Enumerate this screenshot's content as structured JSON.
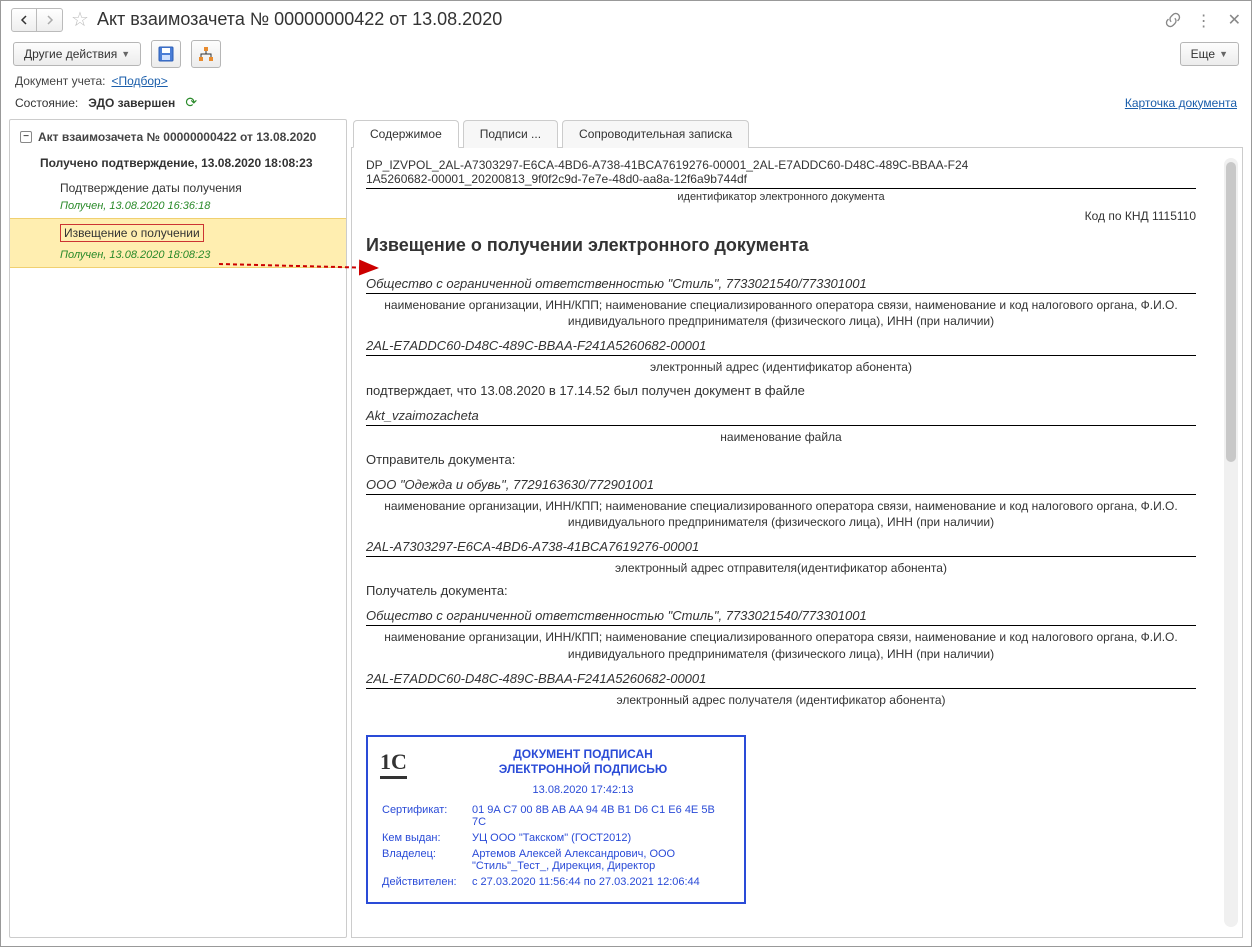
{
  "titlebar": {
    "title": "Акт взаимозачета № 00000000422 от 13.08.2020"
  },
  "toolbar": {
    "other_actions": "Другие действия",
    "more": "Еще"
  },
  "doc_link_row": {
    "label": "Документ учета:",
    "link": "<Подбор>"
  },
  "state_row": {
    "label": "Состояние:",
    "value": "ЭДО завершен",
    "card_link": "Карточка документа"
  },
  "tree": {
    "root": "Акт взаимозачета № 00000000422 от 13.08.2020",
    "subtitle": "Получено подтверждение, 13.08.2020 18:08:23",
    "item1": "Подтверждение даты получения",
    "status1": "Получен, 13.08.2020 16:36:18",
    "item2": "Извещение о получении",
    "status2": "Получен, 13.08.2020 18:08:23"
  },
  "tabs": {
    "t1": "Содержимое",
    "t2": "Подписи ...",
    "t3": "Сопроводительная записка"
  },
  "doc": {
    "id_line1": "DP_IZVPOL_2AL-A7303297-E6CA-4BD6-A738-41BCA7619276-00001_2AL-E7ADDC60-D48C-489C-BBAA-F24",
    "id_line2": "1A5260682-00001_20200813_9f0f2c9d-7e7e-48d0-aa8a-12f6a9b744df",
    "id_caption": "идентификатор электронного документа",
    "knd": "Код по КНД 1115110",
    "h1": "Извещение о получении электронного документа",
    "org1": "Общество с ограниченной ответственностью \"Стиль\", 7733021540/773301001",
    "org_caption": "наименование организации, ИНН/КПП; наименование специализированного оператора связи, наименование и код налогового органа, Ф.И.О. индивидуального предпринимателя (физического лица), ИНН (при наличии)",
    "addr1": "2AL-E7ADDC60-D48C-489C-BBAA-F241A5260682-00001",
    "addr1_caption": "электронный адрес (идентификатор абонента)",
    "confirm_text": "подтверждает, что 13.08.2020 в 17.14.52 был получен документ в файле",
    "filename": "Akt_vzaimozacheta",
    "filename_caption": "наименование файла",
    "sender_label": "Отправитель документа:",
    "sender_org": "ООО \"Одежда и обувь\", 7729163630/772901001",
    "sender_addr": "2AL-A7303297-E6CA-4BD6-A738-41BCA7619276-00001",
    "sender_addr_caption": "электронный адрес отправителя(идентификатор абонента)",
    "recipient_label": "Получатель документа:",
    "recipient_org": "Общество с ограниченной ответственностью \"Стиль\", 7733021540/773301001",
    "recipient_addr": "2AL-E7ADDC60-D48C-489C-BBAA-F241A5260682-00001",
    "recipient_addr_caption": "электронный адрес получателя (идентификатор абонента)"
  },
  "signature": {
    "head1": "ДОКУМЕНТ ПОДПИСАН",
    "head2": "ЭЛЕКТРОННОЙ ПОДПИСЬЮ",
    "date": "13.08.2020 17:42:13",
    "cert_label": "Сертификат:",
    "cert_val": "01 9A C7 00 8B AB AA 94 4B B1 D6 C1 E6 4E 5B 7C",
    "issuer_label": "Кем выдан:",
    "issuer_val": "УЦ ООО \"Такском\" (ГОСТ2012)",
    "owner_label": "Владелец:",
    "owner_val": "Артемов Алексей Александрович, ООО \"Стиль\"_Тест_, Дирекция, Директор",
    "valid_label": "Действителен:",
    "valid_val": "с 27.03.2020 11:56:44 по 27.03.2021 12:06:44",
    "logo": "1C"
  }
}
